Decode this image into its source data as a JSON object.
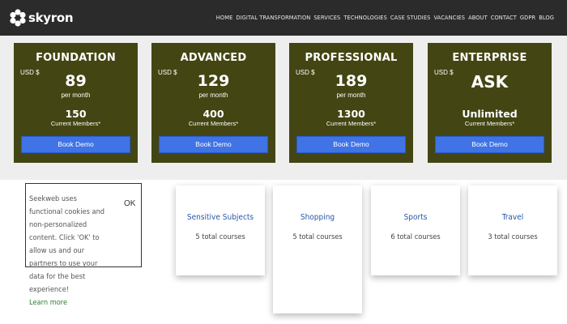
{
  "header": {
    "logo_text": "skyron",
    "nav": [
      "HOME",
      "DIGITAL TRANSFORMATION",
      "SERVICES",
      "TECHNOLOGIES",
      "CASE STUDIES",
      "VACANCIES",
      "ABOUT",
      "CONTACT",
      "GDPR",
      "BLOG"
    ]
  },
  "plans": [
    {
      "name": "FOUNDATION",
      "currency": "USD $",
      "price": "89",
      "period": "per month",
      "members": "150",
      "members_label": "Current Members*",
      "button": "Book Demo"
    },
    {
      "name": "ADVANCED",
      "currency": "USD $",
      "price": "129",
      "period": "per month",
      "members": "400",
      "members_label": "Current Members*",
      "button": "Book Demo"
    },
    {
      "name": "PROFESSIONAL",
      "currency": "USD $",
      "price": "189",
      "period": "per month",
      "members": "1300",
      "members_label": "Current Members*",
      "button": "Book Demo"
    },
    {
      "name": "ENTERPRISE",
      "currency": "USD $",
      "price": "ASK",
      "period": "",
      "members": "Unlimited",
      "members_label": "Current Members*",
      "button": "Book Demo"
    }
  ],
  "cookie": {
    "text": "Seekweb uses functional cookies and non-personalized content. Click 'OK' to allow us and our partners to use your data for the best experience!",
    "link": "Learn more",
    "ok": "OK"
  },
  "categories": [
    {
      "title": "Sensitive Subjects",
      "count": "5 total courses"
    },
    {
      "title": "Shopping",
      "count": "5 total courses"
    },
    {
      "title": "Sports",
      "count": "6 total courses"
    },
    {
      "title": "Travel",
      "count": "3 total courses"
    }
  ],
  "colors": {
    "header_bg": "#2b2b2b",
    "plan_bg": "#434613",
    "button_blue": "#3f73e6",
    "band_bg": "#eeeeee",
    "card_title": "#2a57a8",
    "link_green": "#2e7d2e"
  }
}
